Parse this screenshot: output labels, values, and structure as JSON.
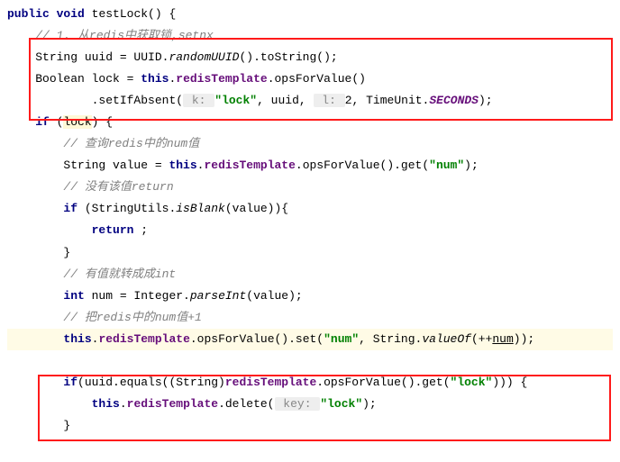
{
  "code": {
    "l1_kw_public": "public",
    "l1_kw_void": "void",
    "l1_method": " testLock() {",
    "l2_comment": "// 1. 从redis中获取锁,setnx",
    "l3_pre": "String uuid = UUID.",
    "l3_rand": "randomUUID",
    "l3_post": "().toString();",
    "l4_pre": "Boolean lock = ",
    "l4_this": "this",
    "l4_dot": ".",
    "l4_fld": "redisTemplate",
    "l4_call": ".opsForValue()",
    "l5_pre": "        .setIfAbsent(",
    "l5_hint1": " k: ",
    "l5_str1": "\"lock\"",
    "l5_mid1": ", uuid, ",
    "l5_hint2": " l: ",
    "l5_num": "2",
    "l5_mid2": ", TimeUnit.",
    "l5_const": "SECONDS",
    "l5_end": ");",
    "l6_if": "if",
    "l6_open": " (",
    "l6_lock": "lock",
    "l6_close": ") {",
    "l7_comment": "// 查询redis中的num值",
    "l8_pre": "String value = ",
    "l8_this": "this",
    "l8_dot": ".",
    "l8_fld": "redisTemplate",
    "l8_call": ".opsForValue().get(",
    "l8_str": "\"num\"",
    "l8_end": ");",
    "l9_comment": "// 没有该值return",
    "l10_if": "if",
    "l10_pre": " (StringUtils.",
    "l10_isblank": "isBlank",
    "l10_post": "(value)){",
    "l11_return": "return",
    "l11_semi": " ;",
    "l12_brace": "}",
    "l13_comment": "// 有值就转成成int",
    "l14_int": "int",
    "l14_pre": " num = Integer.",
    "l14_parse": "parseInt",
    "l14_post": "(value);",
    "l15_comment": "// 把redis中的num值+1",
    "l16_this": "this",
    "l16_dot": ".",
    "l16_fld": "redisTemplate",
    "l16_call1": ".opsForValue().set(",
    "l16_str": "\"num\"",
    "l16_mid": ", String.",
    "l16_valueof": "valueOf",
    "l16_open": "(++",
    "l16_num": "num",
    "l16_end": "));",
    "l17_blank": "",
    "l18_if": "if",
    "l18_pre": "(uuid.equals((String)",
    "l18_fld": "redisTemplate",
    "l18_call": ".opsForValue().get(",
    "l18_str": "\"lock\"",
    "l18_end": "))) {",
    "l19_this": "this",
    "l19_dot": ".",
    "l19_fld": "redisTemplate",
    "l19_del": ".delete(",
    "l19_hint": " key: ",
    "l19_str": "\"lock\"",
    "l19_end": ");",
    "l20_brace": "}"
  }
}
